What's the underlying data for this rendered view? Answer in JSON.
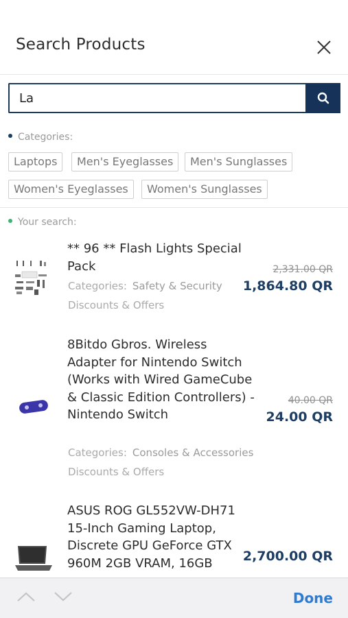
{
  "header": {
    "title": "Search Products"
  },
  "search": {
    "value": "La"
  },
  "categories": {
    "label": "Categories:",
    "chips": [
      "Laptops",
      "Men's Eyeglasses",
      "Men's Sunglasses",
      "Women's Eyeglasses",
      "Women's Sunglasses"
    ]
  },
  "results": {
    "label": "Your search:",
    "items": [
      {
        "name": "** 96 ** Flash Lights Special Pack",
        "categories_label": "Categories:",
        "category": "Safety & Security",
        "discounts": "Discounts & Offers",
        "old_price": "2,331.00 QR",
        "price": "1,864.80 QR"
      },
      {
        "name": "8Bitdo Gbros. Wireless Adapter for Nintendo Switch (Works with Wired GameCube & Classic Edition Controllers) - Nintendo Switch",
        "categories_label": "Categories:",
        "category": "Consoles & Accessories",
        "discounts": "Discounts & Offers",
        "old_price": "40.00 QR",
        "price": "24.00 QR"
      },
      {
        "name": "ASUS ROG GL552VW-DH71 15-Inch Gaming Laptop, Discrete GPU GeForce GTX 960M 2GB VRAM, 16GB",
        "price": "2,700.00 QR"
      }
    ]
  },
  "keyboard_bar": {
    "done_label": "Done"
  },
  "colors": {
    "primary": "#173259",
    "price": "#1d3d63",
    "accent_dot_blue": "#1d3d63",
    "accent_dot_green": "#3cb371",
    "done": "#2e7bd2"
  },
  "icons": {
    "close": "close-icon",
    "search": "search-icon",
    "prev": "chevron-up-icon",
    "next": "chevron-down-icon"
  }
}
